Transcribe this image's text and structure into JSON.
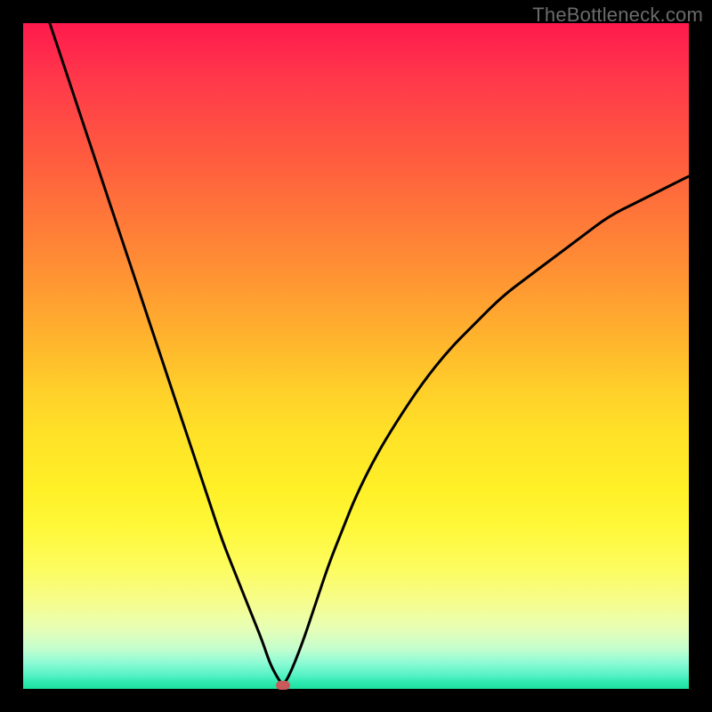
{
  "watermark": "TheBottleneck.com",
  "chart_data": {
    "type": "line",
    "title": "",
    "xlabel": "",
    "ylabel": "",
    "xlim": [
      0,
      100
    ],
    "ylim": [
      0,
      100
    ],
    "series": [
      {
        "name": "bottleneck-curve",
        "x": [
          4,
          6,
          8,
          10,
          12,
          14,
          16,
          18,
          20,
          22,
          24,
          26,
          28,
          30,
          32,
          34,
          36,
          37,
          38,
          39,
          40,
          42,
          44,
          46,
          48,
          50,
          53,
          56,
          60,
          64,
          68,
          72,
          76,
          80,
          84,
          88,
          92,
          96,
          100
        ],
        "y": [
          100,
          94,
          88,
          82,
          76,
          70,
          64,
          58,
          52,
          46,
          40,
          34,
          28,
          22,
          17,
          12,
          7,
          4,
          2,
          0.5,
          2,
          7,
          13,
          19,
          24,
          29,
          35,
          40,
          46,
          51,
          55,
          59,
          62,
          65,
          68,
          71,
          73,
          75,
          77
        ]
      }
    ],
    "marker": {
      "x": 39,
      "y": 0.5
    },
    "gradient_colors": {
      "top": "#ff1a4d",
      "mid": "#fff027",
      "bottom": "#1de29f"
    }
  }
}
